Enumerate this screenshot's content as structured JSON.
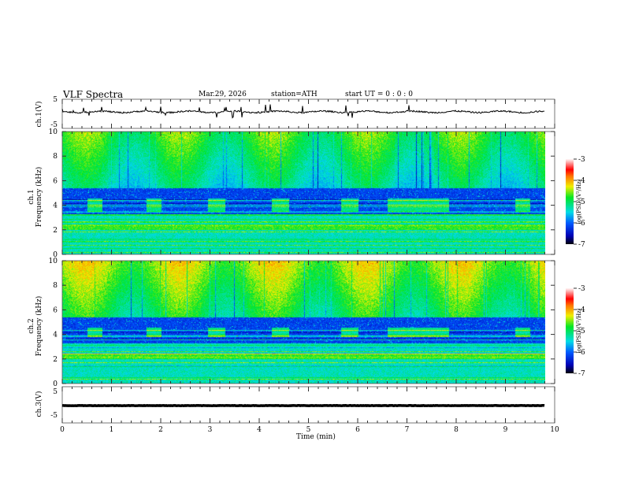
{
  "header": {
    "title": "VLF  Spectra",
    "date": "Mar.29, 2026",
    "station": "station=ATH",
    "start": "start  UT  =   0 : 0  : 0"
  },
  "chart_data": [
    {
      "type": "line",
      "ylabel": "ch.1(V)",
      "ylim": [
        -5,
        5
      ],
      "yticks": [
        "5",
        "-5"
      ],
      "baseline": 0,
      "xlim": [
        0,
        10
      ],
      "data_end": 9.8
    },
    {
      "type": "heatmap",
      "ylabel": "ch.1\nFrequency (kHz)",
      "ylabel_lines": [
        "ch.1",
        "Frequency  (kHz)"
      ],
      "ylim": [
        0,
        10
      ],
      "yticks": [
        "0",
        "2",
        "4",
        "6",
        "8",
        "10"
      ],
      "xlim": [
        0,
        10
      ],
      "data_end": 9.8,
      "colorbar": {
        "label": "log(PSD)(V²/Hz)",
        "range": [
          -7,
          -3
        ],
        "ticks": [
          "-3",
          "-4",
          "-5",
          "-6",
          "-7"
        ]
      },
      "transmitter_bursts_min": [
        [
          0.5,
          0.8
        ],
        [
          1.7,
          2.0
        ],
        [
          2.95,
          3.3
        ],
        [
          4.25,
          4.6
        ],
        [
          5.65,
          6.0
        ],
        [
          6.6,
          7.85
        ],
        [
          9.2,
          9.5
        ]
      ],
      "burst_band_khz": [
        3.5,
        4.6
      ]
    },
    {
      "type": "heatmap",
      "ylabel_lines": [
        "ch.2",
        "Frequency  (kHz)"
      ],
      "ylim": [
        0,
        10
      ],
      "yticks": [
        "0",
        "2",
        "4",
        "6",
        "8",
        "10"
      ],
      "xlim": [
        0,
        10
      ],
      "data_end": 9.8,
      "colorbar": {
        "label": "log(PSD)(V²/Hz)",
        "range": [
          -7,
          -3
        ],
        "ticks": [
          "-3",
          "-4",
          "-5",
          "-6",
          "-7"
        ]
      },
      "transmitter_bursts_min": [
        [
          0.5,
          0.8
        ],
        [
          1.7,
          2.0
        ],
        [
          2.95,
          3.3
        ],
        [
          4.25,
          4.6
        ],
        [
          5.65,
          6.0
        ],
        [
          6.6,
          7.85
        ],
        [
          9.2,
          9.5
        ]
      ],
      "burst_band_khz": [
        3.8,
        4.6
      ]
    },
    {
      "type": "line",
      "ylabel": "ch.3(V)",
      "ylim": [
        -5,
        5
      ],
      "yticks": [
        "5",
        "-5"
      ],
      "baseline": -1,
      "xlim": [
        0,
        10
      ],
      "data_end": 9.8,
      "xlabel": "Time  (min)",
      "xticks": [
        "0",
        "1",
        "2",
        "3",
        "4",
        "5",
        "6",
        "7",
        "8",
        "9",
        "10"
      ]
    }
  ]
}
